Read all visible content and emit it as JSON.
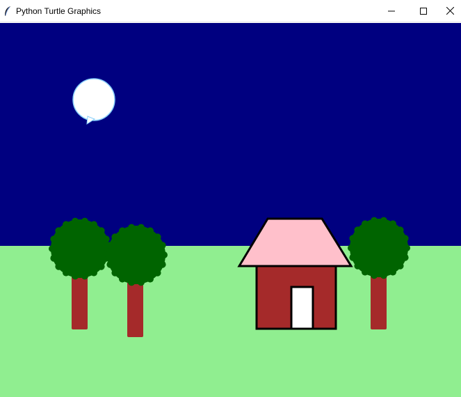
{
  "window": {
    "title": "Python Turtle Graphics",
    "icon": "feather-icon",
    "controls": [
      "minimize-icon",
      "maximize-icon",
      "close-icon"
    ]
  },
  "scene": {
    "sky_color": "#000080",
    "grass_color": "#90ee90",
    "moon_color": "#ffffff",
    "moon_outline_color": "#87cefa",
    "trunk_color": "#a52a2a",
    "leaves_color": "#006400",
    "house_wall_color": "#a52a2a",
    "roof_color": "#ffc0cb",
    "door_color": "#ffffff",
    "outline_color": "#000000"
  }
}
